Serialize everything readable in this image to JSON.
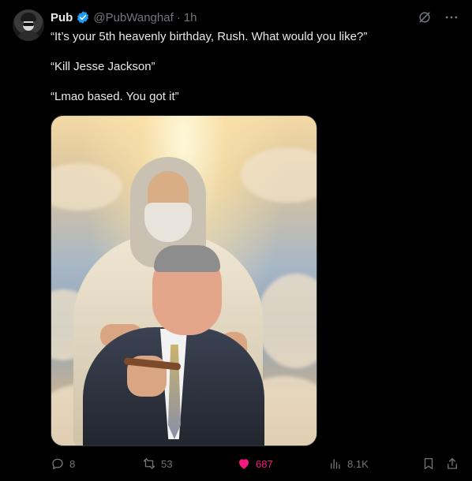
{
  "author": {
    "name": "Pub",
    "handle": "@PubWanghaf",
    "separator": "·",
    "time": "1h"
  },
  "tweet_text": [
    "“It’s your 5th heavenly birthday, Rush. What would you like?”",
    "“Kill Jesse Jackson”",
    "“Lmao based. You got it”"
  ],
  "actions": {
    "replies": "8",
    "retweets": "53",
    "likes": "687",
    "views": "8.1K"
  },
  "colors": {
    "background": "#000000",
    "text": "#e7e9ea",
    "muted": "#71767b",
    "verified": "#1d9bf0",
    "like": "#f91880"
  },
  "icons": {
    "verified": "verified-badge-icon",
    "grok": "grok-icon",
    "more": "more-icon",
    "reply": "reply-icon",
    "retweet": "retweet-icon",
    "like": "heart-filled-icon",
    "views": "views-icon",
    "bookmark": "bookmark-icon",
    "share": "share-icon"
  }
}
